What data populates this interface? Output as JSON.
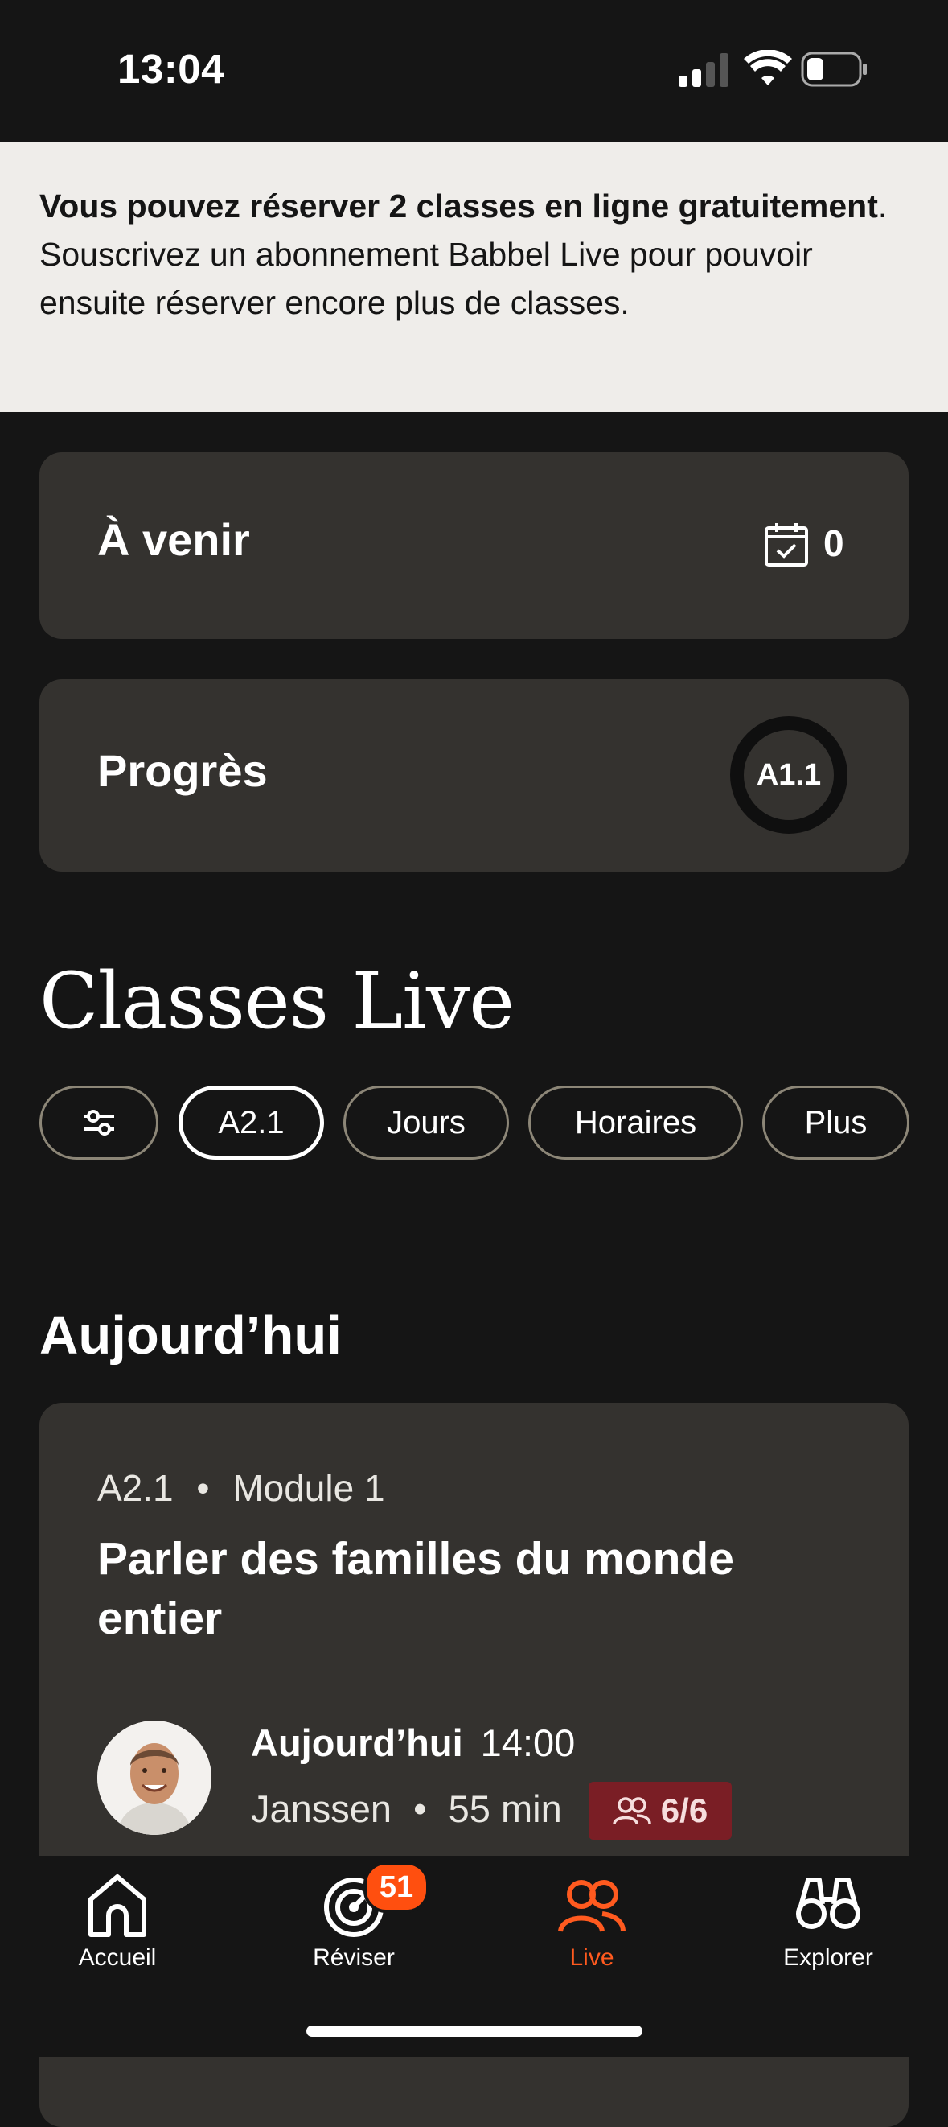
{
  "status_bar": {
    "time": "13:04"
  },
  "banner": {
    "bold": "Vous pouvez réserver 2 classes en ligne gratuitement",
    "rest": ". Souscrivez un abonnement Babbel Live pour pouvoir ensuite réserver encore plus de classes."
  },
  "upcoming": {
    "title": "À venir",
    "count": "0"
  },
  "progress": {
    "title": "Progrès",
    "level": "A1.1"
  },
  "classes": {
    "title": "Classes Live",
    "filters": [
      "A2.1",
      "Jours",
      "Horaires",
      "Plus"
    ]
  },
  "today": {
    "title": "Aujourd’hui",
    "class": {
      "level": "A2.1",
      "separator": "•",
      "module": "Module 1",
      "title": "Parler des familles du monde entier",
      "day": "Aujourd’hui",
      "time": "14:00",
      "teacher": "Janssen",
      "duration": "55 min",
      "seats": "6/6"
    }
  },
  "tabs": [
    {
      "label": "Accueil",
      "icon": "home-icon"
    },
    {
      "label": "Réviser",
      "icon": "target-icon",
      "badge": "51"
    },
    {
      "label": "Live",
      "icon": "people-icon"
    },
    {
      "label": "Explorer",
      "icon": "binoculars-icon"
    }
  ],
  "colors": {
    "accent": "#ff5a1f",
    "card": "#34322f",
    "background": "#151515",
    "seats_badge": "#7a1e25"
  }
}
